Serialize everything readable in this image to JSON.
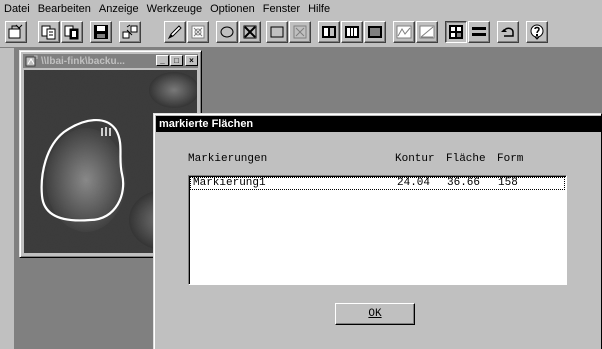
{
  "menu": [
    {
      "key": "datei",
      "label": "Datei"
    },
    {
      "key": "bearbeiten",
      "label": "Bearbeiten"
    },
    {
      "key": "anzeige",
      "label": "Anzeige"
    },
    {
      "key": "werkzeuge",
      "label": "Werkzeuge"
    },
    {
      "key": "optionen",
      "label": "Optionen"
    },
    {
      "key": "fenster",
      "label": "Fenster"
    },
    {
      "key": "hilfe",
      "label": "Hilfe"
    }
  ],
  "toolbar": {
    "buttons": [
      "open-icon",
      "copy-icon",
      "paste-icon",
      "save-icon",
      "transform-icon",
      "draw-icon",
      "erase-icon",
      "ellipse-icon",
      "delete-mark-icon",
      "rect-icon",
      "delete-rect-icon",
      "layout1-icon",
      "layout2-icon",
      "layout3-icon",
      "filter1-icon",
      "filter2-icon",
      "grid-icon",
      "lines-icon",
      "undo-icon",
      "help-icon"
    ]
  },
  "image_window": {
    "title": "\\\\lbai-fink\\backu...",
    "minimize": "_",
    "maximize": "□",
    "close": "×"
  },
  "dialog": {
    "title": "markierte Flächen",
    "columns": {
      "name": "Markierungen",
      "kontur": "Kontur",
      "flaeche": "Fläche",
      "form": "Form"
    },
    "rows": [
      {
        "name": "Markierung1",
        "kontur": "24.04",
        "flaeche": "36.66",
        "form": "158"
      }
    ],
    "ok_label": "OK"
  },
  "colors": {
    "workspace": "#808080",
    "face": "#c0c0c0",
    "active_title": "#000000",
    "inactive_title": "#808080"
  }
}
